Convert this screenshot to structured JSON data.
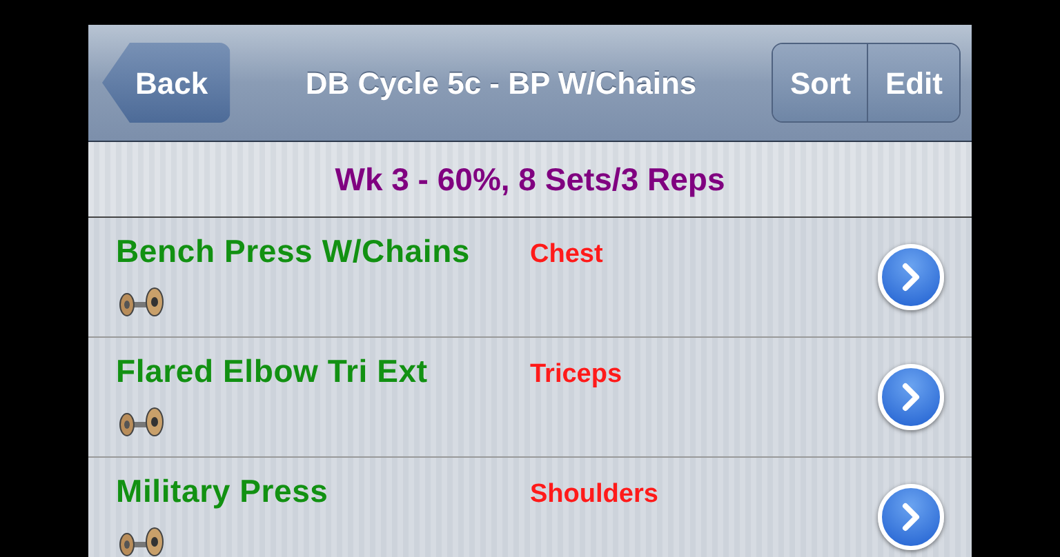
{
  "nav_bar": {
    "back_button": "Back",
    "title": "DB Cycle 5c - BP W/Chains",
    "buttons": [
      "Sort",
      "Edit"
    ]
  },
  "section_header": "Wk 3 - 60%, 8 Sets/3 Reps",
  "exercises": [
    {
      "name": "Bench Press W/Chains",
      "category": "Chest"
    },
    {
      "name": "Flared Elbow Tri Ext",
      "category": "Triceps"
    },
    {
      "name": "Military Press",
      "category": "Shoulders"
    }
  ]
}
